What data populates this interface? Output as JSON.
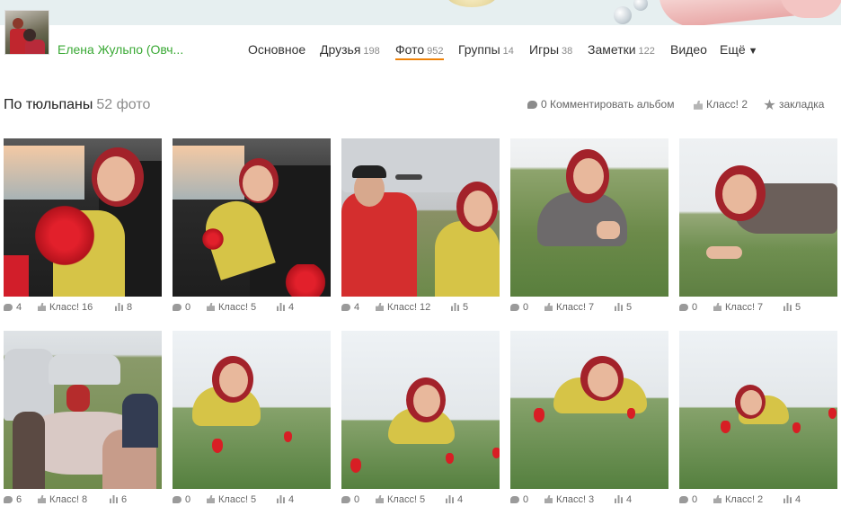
{
  "profile": {
    "name": "Елена Жульпо (Овч..."
  },
  "nav": [
    {
      "label": "Основное",
      "count": "",
      "active": false
    },
    {
      "label": "Друзья",
      "count": "198",
      "active": false
    },
    {
      "label": "Фото",
      "count": "952",
      "active": true
    },
    {
      "label": "Группы",
      "count": "14",
      "active": false
    },
    {
      "label": "Игры",
      "count": "38",
      "active": false
    },
    {
      "label": "Заметки",
      "count": "122",
      "active": false
    },
    {
      "label": "Видео",
      "count": "",
      "active": false
    },
    {
      "label": "Ещё",
      "count": "",
      "active": false,
      "caret": "▼"
    }
  ],
  "album": {
    "title": "По тюльпаны",
    "count": "52 фото",
    "actions": {
      "comments": "0 Комментировать альбом",
      "class": "Класс! 2",
      "bookmark": "закладка"
    }
  },
  "photos": [
    {
      "scene": "car-woman-flowers",
      "comments": "4",
      "klass": "Класс! 16",
      "views": "8"
    },
    {
      "scene": "car-woman-seat",
      "comments": "0",
      "klass": "Класс! 5",
      "views": "4"
    },
    {
      "scene": "couple-car",
      "comments": "4",
      "klass": "Класс! 12",
      "views": "5"
    },
    {
      "scene": "woman-lying-grass",
      "comments": "0",
      "klass": "Класс! 7",
      "views": "5"
    },
    {
      "scene": "woman-lying-grass-2",
      "comments": "0",
      "klass": "Класс! 7",
      "views": "5"
    },
    {
      "scene": "picnic",
      "comments": "6",
      "klass": "Класс! 8",
      "views": "6"
    },
    {
      "scene": "woman-tulips",
      "comments": "0",
      "klass": "Класс! 5",
      "views": "4"
    },
    {
      "scene": "woman-tulips-2",
      "comments": "0",
      "klass": "Класс! 5",
      "views": "4"
    },
    {
      "scene": "woman-tulips-3",
      "comments": "0",
      "klass": "Класс! 3",
      "views": "4"
    },
    {
      "scene": "woman-tulips-4",
      "comments": "0",
      "klass": "Класс! 2",
      "views": "4"
    }
  ],
  "colors": {
    "accent_active": "#ee8208",
    "username": "#3aa935"
  },
  "icons": {
    "comment": "speech-bubble-icon",
    "klass": "thumbs-up-icon",
    "views": "bar-chart-icon",
    "bookmark": "star-icon"
  }
}
